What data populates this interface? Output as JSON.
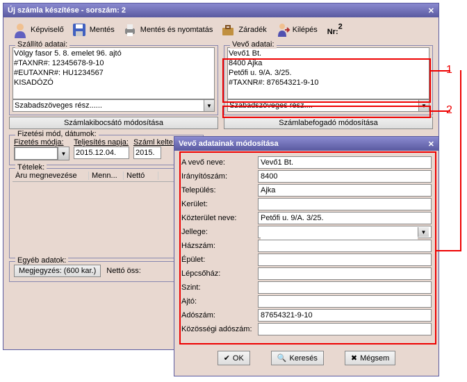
{
  "main": {
    "title": "Új számla készítése - sorszám: 2",
    "toolbar": {
      "kepviselo": "Képviselő",
      "mentes": "Mentés",
      "mentes_nyomtatas": "Mentés és nyomtatás",
      "zaradek": "Záradék",
      "kilepes": "Kilépés",
      "nr_label": "Nr:",
      "nr_value": "2"
    },
    "szallito": {
      "legend": "Szállító adatai:",
      "lines": [
        "Völgy fasor 5. 8. emelet 96. ajtó",
        "#TAXNR#: 12345678-9-10",
        "#EUTAXNR#: HU1234567",
        "KISADÓZÓ"
      ],
      "freetext": "Szabadszöveges rész......",
      "mod_btn": "Számlakibocsátó módosítása"
    },
    "vevo": {
      "legend": "Vevő adatai:",
      "lines": [
        "Vevő1 Bt.",
        "8400 Ajka",
        "Petőfi u. 9/A. 3/25.",
        "#TAXNR#: 87654321-9-10"
      ],
      "freetext": "Szabadszöveges rész....",
      "mod_btn": "Számlabefogadó módosítása"
    },
    "fizetes": {
      "legend": "Fizetési mód, dátumok:",
      "mod_label": "Fizetés módja:",
      "teljesites_label": "Teljesítés napja:",
      "teljesites_value": "2015.12.04.",
      "kelte_label": "Száml kelte:",
      "kelte_value": "2015."
    },
    "tetelek": {
      "legend": "Tételek:",
      "col1": "Áru megnevezése",
      "col2": "Menn...",
      "col3": "Nettó"
    },
    "egyeb": {
      "legend": "Egyéb adatok:",
      "megj_btn": "Megjegyzés: (600 kar.)",
      "netto_label": "Nettó öss:"
    }
  },
  "dialog": {
    "title": "Vevő adatainak módosítása",
    "fields": {
      "nev_label": "A vevő neve:",
      "nev": "Vevő1 Bt.",
      "irsz_label": "Irányítószám:",
      "irsz": "8400",
      "telep_label": "Település:",
      "telep": "Ajka",
      "kerulet_label": "Kerület:",
      "kerulet": "",
      "kozter_label": "Közterület neve:",
      "kozter": "Petőfi u. 9/A. 3/25.",
      "jelleg_label": "Jellege:",
      "jelleg": "",
      "hazszam_label": "Házszám:",
      "hazszam": "",
      "epulet_label": "Épület:",
      "epulet": "",
      "lepcso_label": "Lépcsőház:",
      "lepcso": "",
      "szint_label": "Szint:",
      "szint": "",
      "ajto_label": "Ajtó:",
      "ajto": "",
      "adoszam_label": "Adószám:",
      "adoszam": "87654321-9-10",
      "euado_label": "Közösségi adószám:",
      "euado": ""
    },
    "btn_ok": "OK",
    "btn_kereses": "Keresés",
    "btn_megsem": "Mégsem"
  },
  "annotations": {
    "a1": "1",
    "a2": "2"
  }
}
